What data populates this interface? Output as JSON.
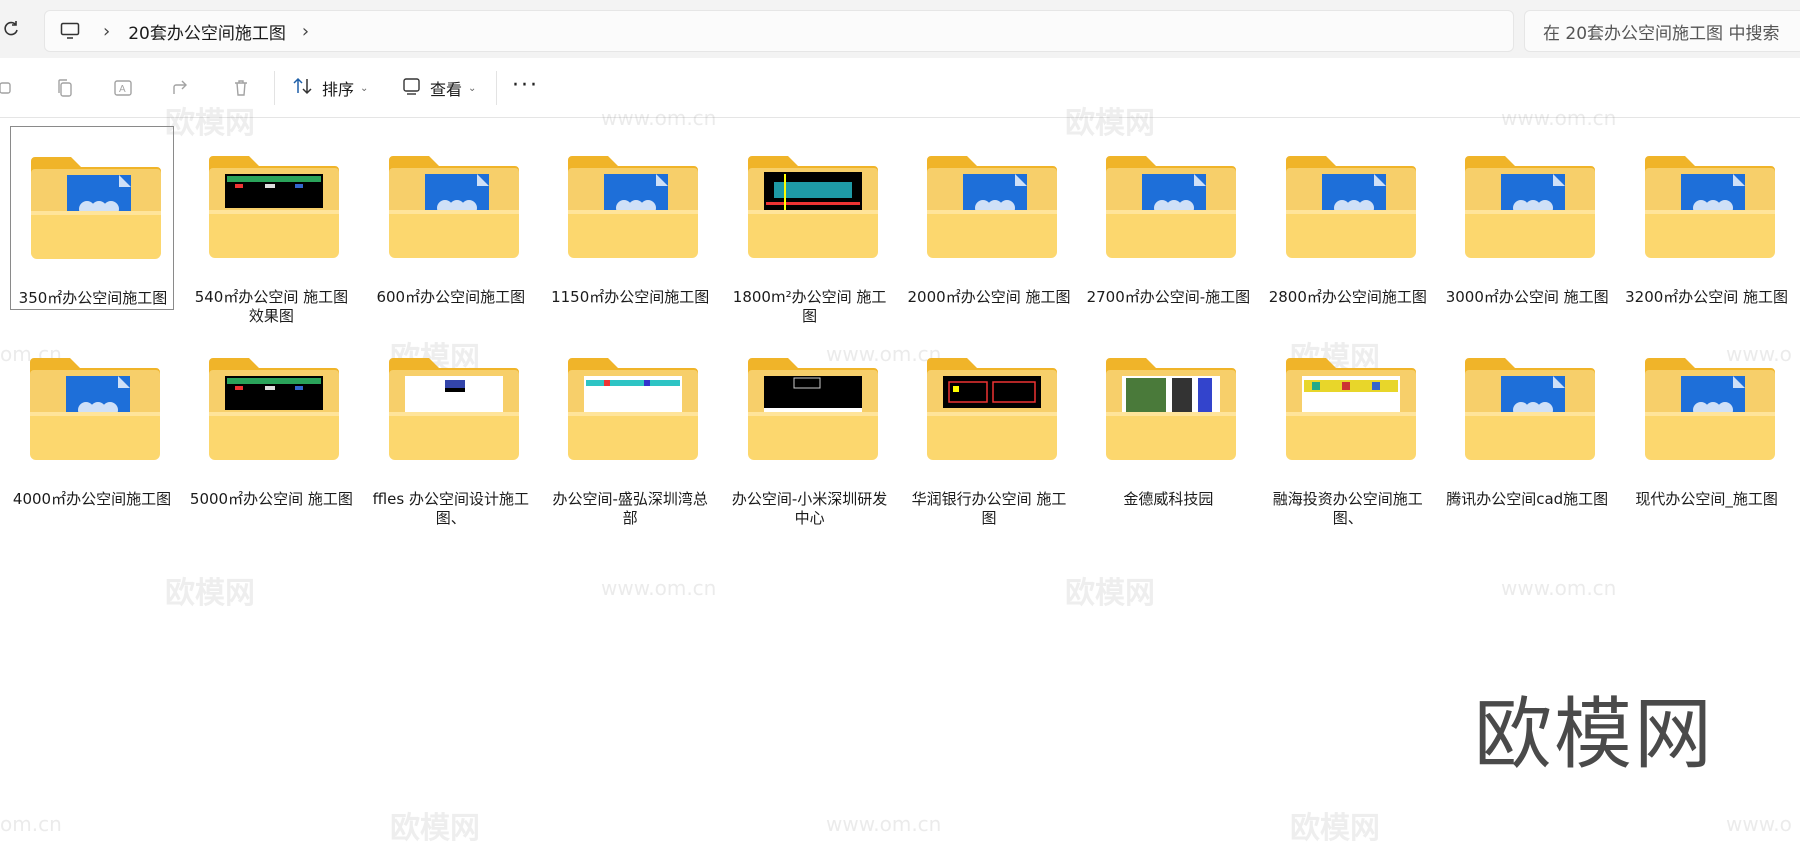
{
  "header": {
    "refresh_icon": "refresh-icon",
    "computer_icon": "monitor-icon",
    "breadcrumb": "20套办公空间施工图",
    "search_placeholder": "在 20套办公空间施工图 中搜索"
  },
  "toolbar": {
    "sort_label": "排序",
    "view_label": "查看",
    "more_label": "···"
  },
  "folders": [
    {
      "label": "350㎡办公空间施工图",
      "thumb": "default"
    },
    {
      "label": "540㎡办公空间 施工图效果图",
      "thumb": "cad-dark"
    },
    {
      "label": "600㎡办公空间施工图",
      "thumb": "default"
    },
    {
      "label": "1150㎡办公空间施工图",
      "thumb": "default"
    },
    {
      "label": "1800m²办公空间 施工图",
      "thumb": "cad-blue"
    },
    {
      "label": "2000㎡办公空间 施工图",
      "thumb": "default"
    },
    {
      "label": "2700㎡办公空间-施工图",
      "thumb": "default"
    },
    {
      "label": "2800㎡办公空间施工图",
      "thumb": "default"
    },
    {
      "label": "3000㎡办公空间 施工图",
      "thumb": "default"
    },
    {
      "label": "3200㎡办公空间 施工图",
      "thumb": "default"
    },
    {
      "label": "4000㎡办公空间施工图",
      "thumb": "default"
    },
    {
      "label": "5000㎡办公空间 施工图",
      "thumb": "cad-dark"
    },
    {
      "label": "ffles 办公空间设计施工图、",
      "thumb": "cad-white"
    },
    {
      "label": "办公空间-盛弘深圳湾总部",
      "thumb": "cad-cyan"
    },
    {
      "label": "办公空间-小米深圳研发中心",
      "thumb": "cad-black"
    },
    {
      "label": "华润银行办公空间 施工图",
      "thumb": "cad-red"
    },
    {
      "label": "金德威科技园",
      "thumb": "cad-grid"
    },
    {
      "label": "融海投资办公空间施工图、",
      "thumb": "cad-yellow"
    },
    {
      "label": "腾讯办公空间cad施工图",
      "thumb": "default"
    },
    {
      "label": "现代办公空间_施工图",
      "thumb": "default"
    }
  ],
  "watermark": {
    "brand": "欧模网",
    "site": "www.om.cn",
    "site_partial": "om.cn",
    "site_cut": "www.o"
  },
  "colors": {
    "folder_back": "#f0b429",
    "folder_front": "#fcd76e",
    "doc_blue": "#1e6fd9",
    "selection_border": "#8a8a8a"
  }
}
